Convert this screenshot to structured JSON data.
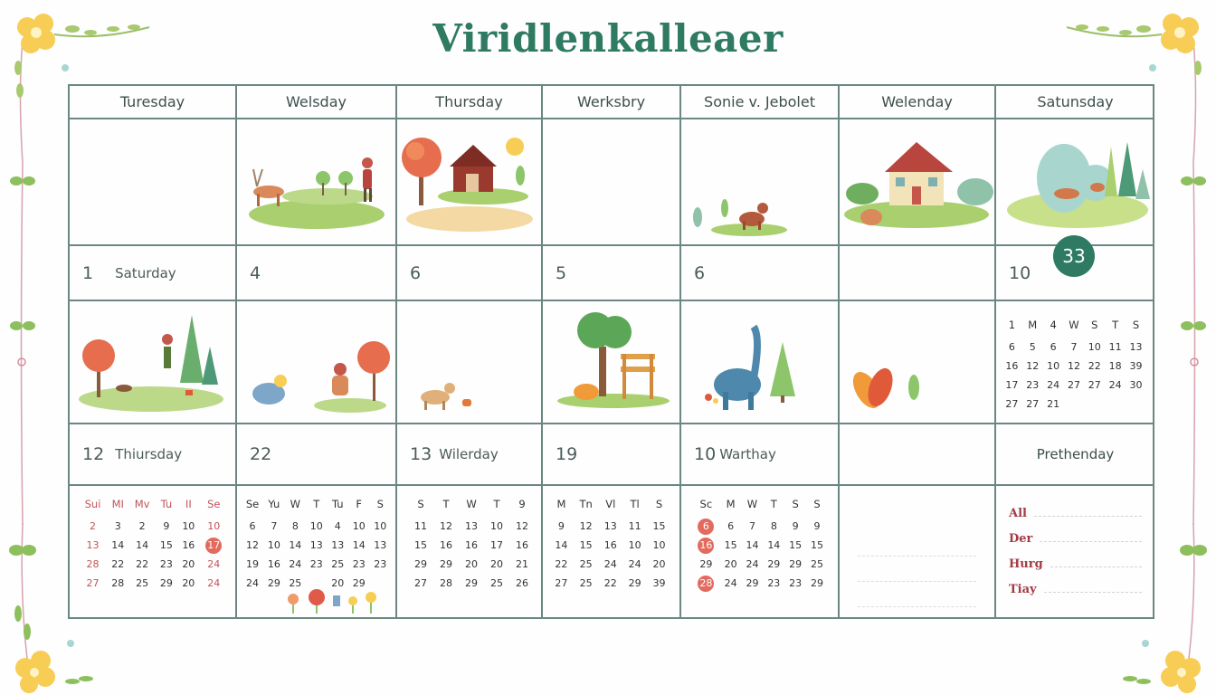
{
  "title": "Viridlenkalleaer",
  "header_days": [
    "Turesday",
    "Welsday",
    "Thursday",
    "Werksbry",
    "Sonie v. Jebolet",
    "Welenday",
    "Satunsday"
  ],
  "badge": "33",
  "row2_days": [
    {
      "num": "1",
      "label": "Saturday"
    },
    {
      "num": "4",
      "label": ""
    },
    {
      "num": "6",
      "label": ""
    },
    {
      "num": "5",
      "label": ""
    },
    {
      "num": "6",
      "label": ""
    },
    {
      "num": "",
      "label": ""
    },
    {
      "num": "10",
      "label": ""
    }
  ],
  "row4_days": [
    {
      "num": "12",
      "label": "Thiursday"
    },
    {
      "num": "22",
      "label": ""
    },
    {
      "num": "13",
      "label": "Wilerday"
    },
    {
      "num": "19",
      "label": ""
    },
    {
      "num": "10",
      "label": "Warthay"
    },
    {
      "num": "",
      "label": ""
    },
    {
      "num": "",
      "label": "Prethenday"
    }
  ],
  "scenes": {
    "row1": [
      "",
      "deer-girl-meadow",
      "autumn-tree-cabin-sun",
      "",
      "plants-dog",
      "cottage-cat",
      "deer-forest"
    ],
    "row3": [
      "autumn-girl-trees",
      "bird-child-tree",
      "goat-apple",
      "tree-fox-sign",
      "dinosaur-pine",
      "leaves",
      "mini-calendar"
    ]
  },
  "mini_calendars": {
    "top_right": {
      "head": [
        "1",
        "M",
        "4",
        "W",
        "S",
        "T",
        "S"
      ],
      "rows": [
        [
          "6",
          "5",
          "6",
          "7",
          "10",
          "11",
          "13"
        ],
        [
          "16",
          "12",
          "10",
          "12",
          "22",
          "18",
          "39"
        ],
        [
          "17",
          "23",
          "24",
          "27",
          "27",
          "24",
          "30"
        ],
        [
          "27",
          "27",
          "21",
          "",
          "",
          "",
          ""
        ]
      ]
    },
    "c1": {
      "head": [
        "Sui",
        "MI",
        "Mv",
        "Tu",
        "II",
        "Se"
      ],
      "rows": [
        [
          "2",
          "3",
          "2",
          "9",
          "10",
          "10"
        ],
        [
          "13",
          "14",
          "14",
          "15",
          "16",
          "17"
        ],
        [
          "28",
          "22",
          "22",
          "23",
          "20",
          "24"
        ],
        [
          "27",
          "28",
          "25",
          "29",
          "20",
          "24"
        ]
      ],
      "circled": "17"
    },
    "c2": {
      "head": [
        "Se",
        "Yu",
        "W",
        "T",
        "Tu",
        "F",
        "S"
      ],
      "rows": [
        [
          "6",
          "7",
          "8",
          "10",
          "4",
          "10",
          "10"
        ],
        [
          "12",
          "10",
          "14",
          "13",
          "13",
          "14",
          "13"
        ],
        [
          "19",
          "16",
          "24",
          "23",
          "25",
          "23",
          "23"
        ],
        [
          "24",
          "29",
          "25",
          "",
          "20",
          "29",
          ""
        ]
      ]
    },
    "c3": {
      "head": [
        "S",
        "T",
        "W",
        "T",
        "9"
      ],
      "rows": [
        [
          "11",
          "12",
          "13",
          "10",
          "12"
        ],
        [
          "15",
          "16",
          "16",
          "17",
          "16"
        ],
        [
          "29",
          "29",
          "20",
          "20",
          "21"
        ],
        [
          "27",
          "28",
          "29",
          "25",
          "26"
        ]
      ]
    },
    "c4": {
      "head": [
        "M",
        "Tn",
        "Vl",
        "Tl",
        "S"
      ],
      "rows": [
        [
          "9",
          "12",
          "13",
          "11",
          "15"
        ],
        [
          "14",
          "15",
          "16",
          "10",
          "10"
        ],
        [
          "22",
          "25",
          "24",
          "24",
          "20"
        ],
        [
          "27",
          "25",
          "22",
          "29",
          "39"
        ]
      ]
    },
    "c5": {
      "head": [
        "Sc",
        "M",
        "W",
        "T",
        "S",
        "S"
      ],
      "rows": [
        [
          "6",
          "6",
          "7",
          "8",
          "9",
          "9"
        ],
        [
          "16",
          "15",
          "14",
          "14",
          "15",
          "15"
        ],
        [
          "29",
          "20",
          "24",
          "29",
          "29",
          "25"
        ],
        [
          "28",
          "24",
          "29",
          "23",
          "23",
          "29"
        ]
      ],
      "circled": [
        "6",
        "16",
        "28"
      ]
    }
  },
  "notes": [
    "All",
    "Der",
    "Hurg",
    "Tiay"
  ],
  "colors": {
    "accent": "#2f7a62",
    "grid": "#6b8783",
    "holiday": "#c2545a",
    "highlight": "#e36a5e"
  }
}
